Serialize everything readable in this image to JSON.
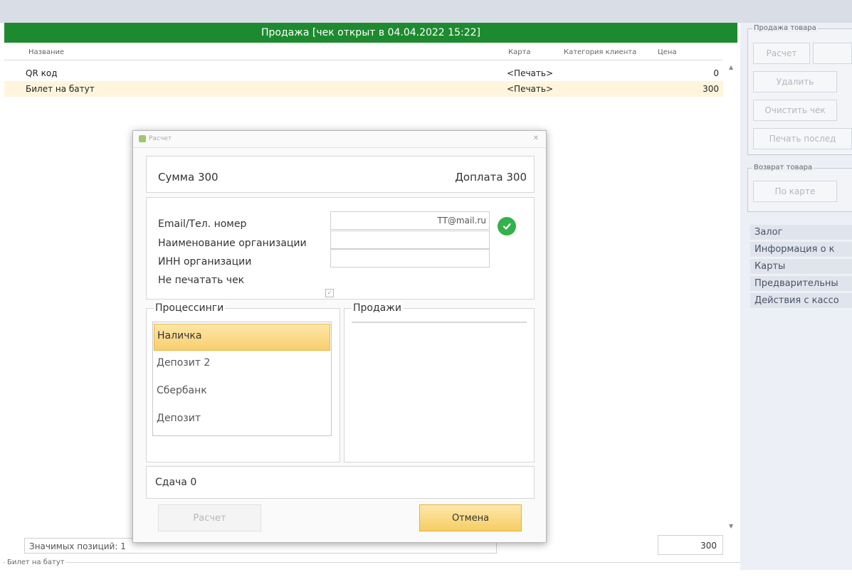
{
  "window": {
    "title": "Продажа [чек открыт в 04.04.2022 15:22]"
  },
  "table": {
    "columns": [
      "Название",
      "Карта",
      "Категория клиента",
      "Цена"
    ],
    "rows": [
      {
        "name": "QR код",
        "card": "<Печать>",
        "price": "0"
      },
      {
        "name": "Билет на батут",
        "card": "<Печать>",
        "price": "300"
      }
    ]
  },
  "footer": {
    "significant_positions": "Значимых позиций: 1",
    "total": "300",
    "group_label": "Билет на батут"
  },
  "right_panel": {
    "sale_group": "Продажа товара",
    "sale_buttons": [
      "Расчет",
      "Удалить",
      "Очистить чек",
      "Печать послед"
    ],
    "return_group": "Возврат товара",
    "return_button": "По карте",
    "sections": [
      "Залог",
      "Информация о к",
      "Карты",
      "Предварительны",
      "Действия с кассо"
    ]
  },
  "dialog": {
    "title": "Расчет",
    "sum": "Сумма 300",
    "extra_payment": "Доплата 300",
    "fields": {
      "email_label": "Email/Тел. номер",
      "email_value": "TT@mail.ru",
      "org_name_label": "Наименование организации",
      "org_name_value": "",
      "inn_label": "ИНН организации",
      "inn_value": "",
      "no_print_label": "Не печатать чек"
    },
    "processings": {
      "label": "Процессинги",
      "items": [
        "Наличка",
        "Депозит 2",
        "Сбербанк",
        "Депозит"
      ]
    },
    "sales": {
      "label": "Продажи"
    },
    "change": "Сдача 0",
    "buttons": {
      "calculate": "Расчет",
      "cancel": "Отмена"
    }
  },
  "icons": {
    "email_status": "check-circle-icon",
    "dialog_close": "close-icon"
  },
  "colors": {
    "title_bar": "#1e8a2f",
    "selected_row": "#fff5dc",
    "selected_item": "#f8cf6f",
    "ok_icon": "#34b14b"
  }
}
